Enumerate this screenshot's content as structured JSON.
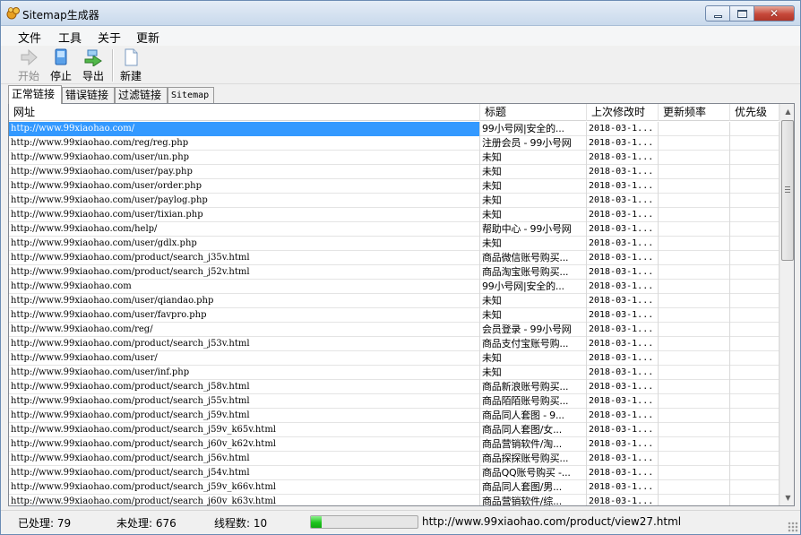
{
  "window": {
    "title": "Sitemap生成器"
  },
  "menu": [
    "文件",
    "工具",
    "关于",
    "更新"
  ],
  "toolbar": {
    "start": "开始",
    "stop": "停止",
    "export": "导出",
    "new": "新建"
  },
  "tabs": [
    "正常链接",
    "错误链接",
    "过滤链接",
    "Sitemap"
  ],
  "table": {
    "columns": [
      "网址",
      "标题",
      "上次修改时",
      "更新频率",
      "优先级"
    ],
    "rows": [
      [
        "http://www.99xiaohao.com/",
        "99小号网|安全的...",
        "2018-03-1..."
      ],
      [
        "http://www.99xiaohao.com/reg/reg.php",
        "注册会员 - 99小号网",
        "2018-03-1..."
      ],
      [
        "http://www.99xiaohao.com/user/un.php",
        "未知",
        "2018-03-1..."
      ],
      [
        "http://www.99xiaohao.com/user/pay.php",
        "未知",
        "2018-03-1..."
      ],
      [
        "http://www.99xiaohao.com/user/order.php",
        "未知",
        "2018-03-1..."
      ],
      [
        "http://www.99xiaohao.com/user/paylog.php",
        "未知",
        "2018-03-1..."
      ],
      [
        "http://www.99xiaohao.com/user/tixian.php",
        "未知",
        "2018-03-1..."
      ],
      [
        "http://www.99xiaohao.com/help/",
        "帮助中心 - 99小号网",
        "2018-03-1..."
      ],
      [
        "http://www.99xiaohao.com/user/gdlx.php",
        "未知",
        "2018-03-1..."
      ],
      [
        "http://www.99xiaohao.com/product/search_j35v.html",
        "商品微信账号购买...",
        "2018-03-1..."
      ],
      [
        "http://www.99xiaohao.com/product/search_j52v.html",
        "商品淘宝账号购买...",
        "2018-03-1..."
      ],
      [
        "http://www.99xiaohao.com",
        "99小号网|安全的...",
        "2018-03-1..."
      ],
      [
        "http://www.99xiaohao.com/user/qiandao.php",
        "未知",
        "2018-03-1..."
      ],
      [
        "http://www.99xiaohao.com/user/favpro.php",
        "未知",
        "2018-03-1..."
      ],
      [
        "http://www.99xiaohao.com/reg/",
        "会员登录 - 99小号网",
        "2018-03-1..."
      ],
      [
        "http://www.99xiaohao.com/product/search_j53v.html",
        "商品支付宝账号购...",
        "2018-03-1..."
      ],
      [
        "http://www.99xiaohao.com/user/",
        "未知",
        "2018-03-1..."
      ],
      [
        "http://www.99xiaohao.com/user/inf.php",
        "未知",
        "2018-03-1..."
      ],
      [
        "http://www.99xiaohao.com/product/search_j58v.html",
        "商品新浪账号购买...",
        "2018-03-1..."
      ],
      [
        "http://www.99xiaohao.com/product/search_j55v.html",
        "商品陌陌账号购买...",
        "2018-03-1..."
      ],
      [
        "http://www.99xiaohao.com/product/search_j59v.html",
        "商品同人套图 - 9...",
        "2018-03-1..."
      ],
      [
        "http://www.99xiaohao.com/product/search_j59v_k65v.html",
        "商品同人套图/女...",
        "2018-03-1..."
      ],
      [
        "http://www.99xiaohao.com/product/search_j60v_k62v.html",
        "商品营销软件/淘...",
        "2018-03-1..."
      ],
      [
        "http://www.99xiaohao.com/product/search_j56v.html",
        "商品探探账号购买...",
        "2018-03-1..."
      ],
      [
        "http://www.99xiaohao.com/product/search_j54v.html",
        "商品QQ账号购买 -...",
        "2018-03-1..."
      ],
      [
        "http://www.99xiaohao.com/product/search_j59v_k66v.html",
        "商品同人套图/男...",
        "2018-03-1..."
      ],
      [
        "http://www.99xiaohao.com/product/search_j60v_k63v.html",
        "商品营销软件/综...",
        "2018-03-1..."
      ]
    ],
    "selected_row": 0
  },
  "status": {
    "processed": "已处理: 79",
    "unprocessed": "未处理: 676",
    "threads": "线程数: 10",
    "progress": 0.1,
    "current_url": "http://www.99xiaohao.com/product/view27.html"
  },
  "colors": {
    "selection": "#3399ff",
    "progress": "#1ec41e",
    "close_button": "#c6483a"
  }
}
